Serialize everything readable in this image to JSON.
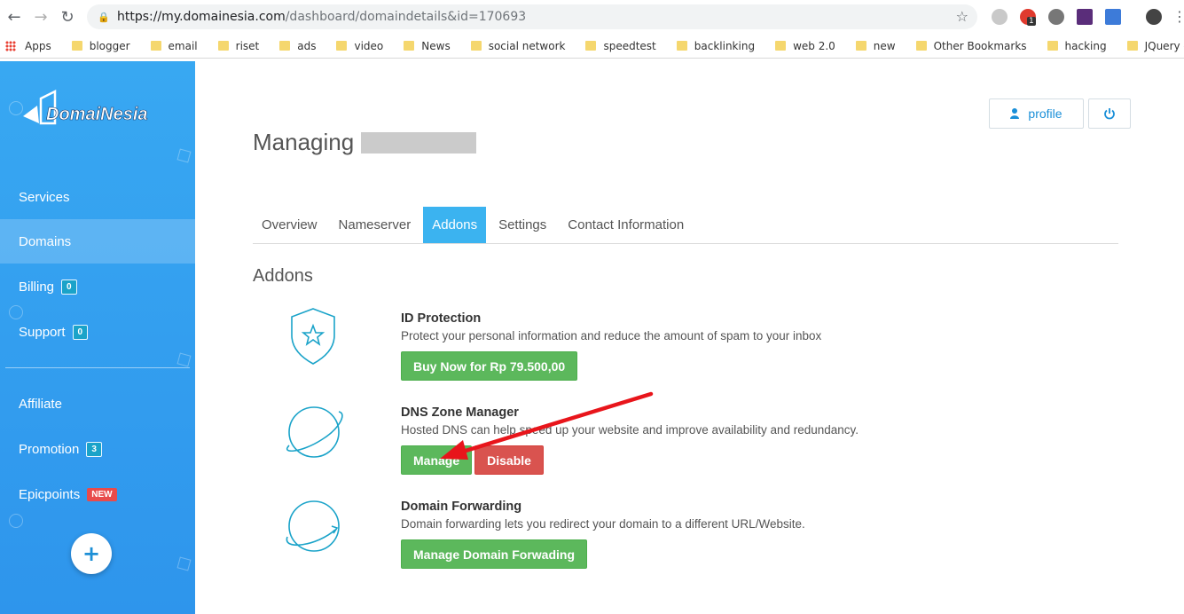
{
  "browser": {
    "url_host": "https://my.domainesia.com",
    "url_path": "/dashboard/domaindetails&id=170693",
    "extension_badge": "1",
    "bookmarks": [
      "Apps",
      "blogger",
      "email",
      "riset",
      "ads",
      "video",
      "News",
      "social network",
      "speedtest",
      "backlinking",
      "web 2.0",
      "new",
      "Other Bookmarks",
      "hacking",
      "JQuery - how to appe"
    ]
  },
  "sidebar": {
    "logo_text": "DomaiNesia",
    "items": [
      {
        "label": "Services",
        "badge": null
      },
      {
        "label": "Domains",
        "badge": null,
        "active": true
      },
      {
        "label": "Billing",
        "badge": "0"
      },
      {
        "label": "Support",
        "badge": "0"
      },
      {
        "label": "Affiliate",
        "badge": null
      },
      {
        "label": "Promotion",
        "badge": "3"
      },
      {
        "label": "Epicpoints",
        "badge": "NEW"
      }
    ],
    "fab_label": "+"
  },
  "header": {
    "title": "Managing",
    "profile_label": "profile"
  },
  "tabs": [
    "Overview",
    "Nameserver",
    "Addons",
    "Settings",
    "Contact Information"
  ],
  "active_tab": "Addons",
  "section_title": "Addons",
  "addons": [
    {
      "name": "ID Protection",
      "desc": "Protect your personal information and reduce the amount of spam to your inbox",
      "buttons": [
        "Buy Now for Rp 79.500,00"
      ]
    },
    {
      "name": "DNS Zone Manager",
      "desc": "Hosted DNS can help speed up your website and improve availability and redundancy.",
      "buttons": [
        "Manage",
        "Disable"
      ]
    },
    {
      "name": "Domain Forwarding",
      "desc": "Domain forwarding lets you redirect your domain to a different URL/Website.",
      "buttons": [
        "Manage Domain Forwading"
      ]
    }
  ],
  "colors": {
    "sidebar": "#2e95ec",
    "accent": "#3bb3f0",
    "green": "#5cb85c",
    "red": "#d9534f",
    "annotation_arrow": "#e8151b"
  }
}
